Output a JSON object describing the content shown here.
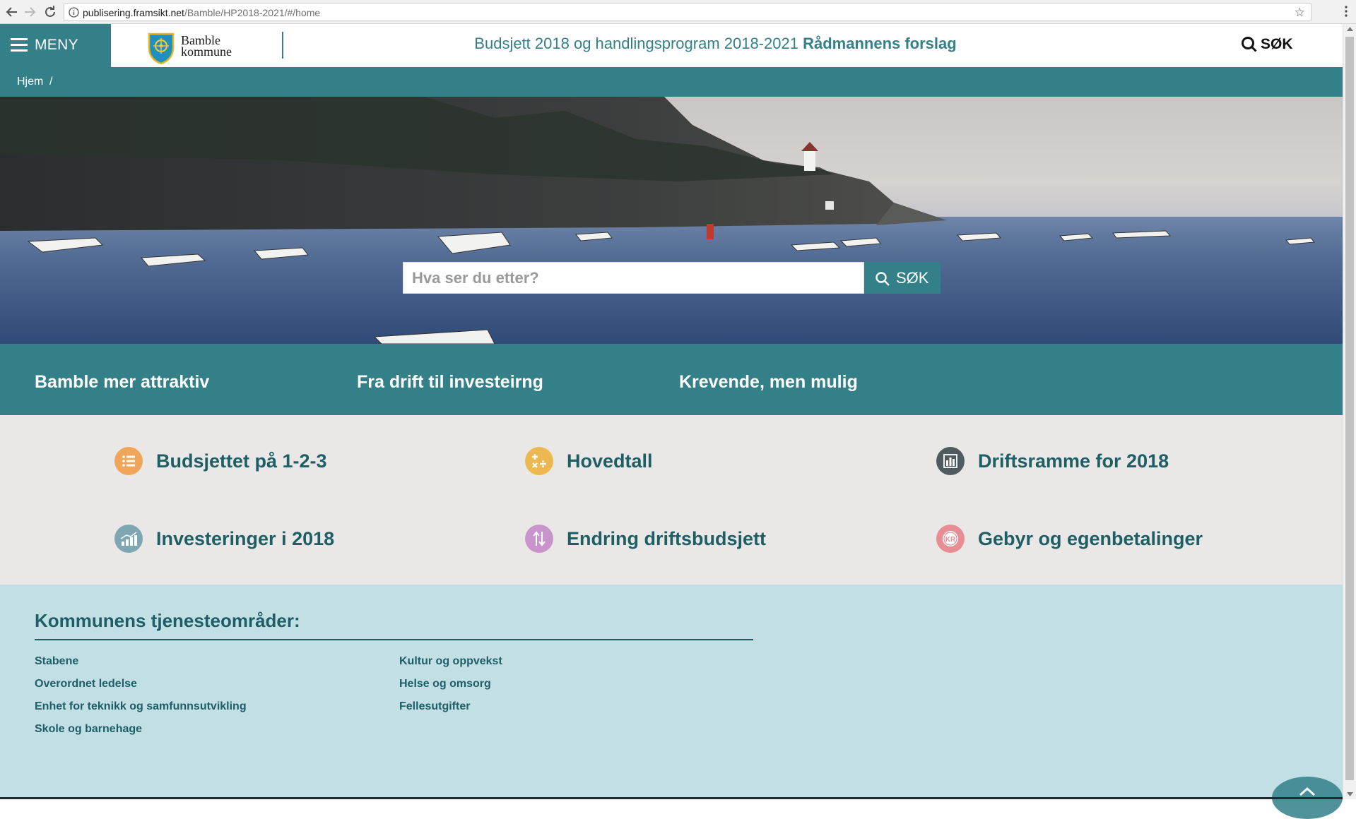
{
  "browser": {
    "url_host": "publisering.framsikt.net",
    "url_path": "/Bamble/HP2018-2021/#/home"
  },
  "header": {
    "menu_label": "MENY",
    "logo_line1": "Bamble",
    "logo_line2": "kommune",
    "title_regular": "Budsjett 2018 og handlingsprogram 2018-2021",
    "title_strong": "Rådmannens forslag",
    "search_label": "SØK"
  },
  "breadcrumb": {
    "home": "Hjem",
    "separator": "/"
  },
  "hero": {
    "search_placeholder": "Hva ser du etter?",
    "search_button_label": "SØK"
  },
  "headlines": [
    "Bamble mer attraktiv",
    "Fra drift til investeirng",
    "Krevende, men mulig"
  ],
  "quick_links": [
    {
      "label": "Budsjettet på 1-2-3",
      "icon": "list-icon",
      "color": "#f0a65a"
    },
    {
      "label": "Hovedtall",
      "icon": "calculator-icon",
      "color": "#ecb84f"
    },
    {
      "label": "Driftsramme for 2018",
      "icon": "bar-chart-icon",
      "color": "#4f5b5e"
    },
    {
      "label": "Investeringer i 2018",
      "icon": "growth-chart-icon",
      "color": "#7ea6b3"
    },
    {
      "label": "Endring driftsbudsjett",
      "icon": "change-arrows-icon",
      "color": "#c994cc"
    },
    {
      "label": "Gebyr og egenbetalinger",
      "icon": "kr-coin-icon",
      "color": "#e88d92"
    }
  ],
  "services": {
    "title": "Kommunens tjenesteområder:",
    "column1": [
      "Stabene",
      "Overordnet ledelse",
      "Enhet for teknikk og samfunnsutvikling",
      "Skole og barnehage"
    ],
    "column2": [
      "Kultur og oppvekst",
      "Helse og omsorg",
      "Fellesutgifter"
    ]
  },
  "colors": {
    "teal": "#338089",
    "dark_teal_text": "#1e5e65",
    "light_grey_band": "#e9e8e6",
    "light_blue_band": "#c2dfe6"
  }
}
